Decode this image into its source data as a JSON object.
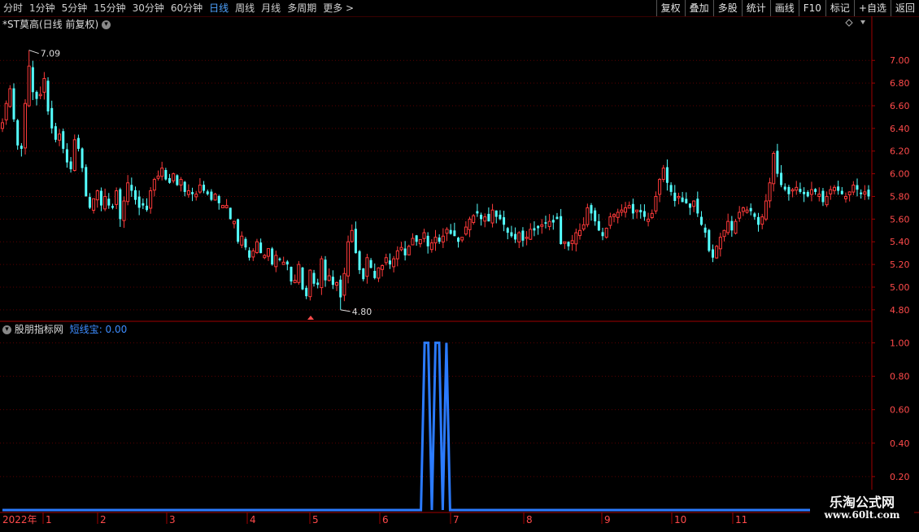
{
  "toolbar": {
    "periods": [
      "分时",
      "1分钟",
      "5分钟",
      "15分钟",
      "30分钟",
      "60分钟",
      "日线",
      "周线",
      "月线",
      "多周期",
      "更多 >"
    ],
    "active_period": "日线",
    "right_buttons": [
      "复权",
      "叠加",
      "多股",
      "统计",
      "画线",
      "F10",
      "标记",
      "+自选",
      "返回"
    ]
  },
  "main_panel": {
    "title": "*ST莫高(日线 前复权)",
    "high_label": "7.09",
    "low_label": "4.80",
    "y_ticks": [
      "7.00",
      "6.80",
      "6.60",
      "6.40",
      "6.20",
      "6.00",
      "5.80",
      "5.60",
      "5.40",
      "5.20",
      "5.00",
      "4.80"
    ]
  },
  "indicator_panel": {
    "title": "股朋指标网",
    "indicator_name": "短线宝",
    "indicator_value": "0.00",
    "y_ticks": [
      "1.00",
      "0.80",
      "0.60",
      "0.40",
      "0.20"
    ]
  },
  "x_axis": {
    "year_label": "2022年",
    "month_labels": [
      "1",
      "2",
      "3",
      "4",
      "5",
      "6",
      "7",
      "8",
      "9",
      "10",
      "11"
    ]
  },
  "watermark": {
    "line1": "乐淘公式网",
    "line2": "www.60lt.com"
  },
  "colors": {
    "up": "#ff3a3a",
    "down": "#54ffff",
    "indicator": "#2b7bff",
    "axis": "#a00000",
    "active": "#4fa3ff"
  },
  "chart_data": {
    "type": "candlestick",
    "price_range": [
      4.72,
      7.26
    ],
    "closes": [
      6.45,
      6.62,
      6.75,
      6.48,
      6.25,
      6.22,
      6.62,
      6.95,
      6.72,
      6.66,
      6.7,
      6.84,
      6.55,
      6.4,
      6.3,
      6.35,
      6.22,
      6.1,
      6.04,
      6.3,
      6.22,
      6.05,
      5.8,
      5.7,
      5.78,
      5.85,
      5.72,
      5.8,
      5.72,
      5.7,
      5.85,
      5.6,
      5.76,
      5.92,
      5.85,
      5.77,
      5.7,
      5.72,
      5.68,
      5.85,
      5.95,
      5.98,
      6.05,
      5.95,
      5.92,
      6.0,
      5.9,
      5.95,
      5.84,
      5.85,
      5.82,
      5.82,
      5.9,
      5.85,
      5.82,
      5.77,
      5.82,
      5.74,
      5.72,
      5.72,
      5.6,
      5.58,
      5.4,
      5.45,
      5.35,
      5.26,
      5.32,
      5.4,
      5.3,
      5.28,
      5.34,
      5.2,
      5.28,
      5.24,
      5.22,
      5.2,
      5.05,
      5.06,
      5.2,
      4.98,
      4.92,
      5.15,
      5.03,
      5.02,
      5.25,
      5.06,
      5.1,
      5.02,
      5.04,
      4.91,
      5.12,
      5.4,
      5.5,
      5.3,
      5.15,
      5.07,
      5.26,
      5.17,
      5.08,
      5.17,
      5.19,
      5.26,
      5.2,
      5.25,
      5.32,
      5.35,
      5.28,
      5.36,
      5.43,
      5.4,
      5.42,
      5.48,
      5.36,
      5.39,
      5.44,
      5.4,
      5.45,
      5.51,
      5.47,
      5.45,
      5.4,
      5.44,
      5.53,
      5.6,
      5.63,
      5.65,
      5.6,
      5.62,
      5.58,
      5.68,
      5.62,
      5.6,
      5.55,
      5.48,
      5.45,
      5.42,
      5.48,
      5.41,
      5.44,
      5.51,
      5.5,
      5.52,
      5.55,
      5.56,
      5.58,
      5.57,
      5.6,
      5.38,
      5.4,
      5.36,
      5.41,
      5.48,
      5.5,
      5.55,
      5.7,
      5.65,
      5.58,
      5.5,
      5.45,
      5.52,
      5.62,
      5.64,
      5.66,
      5.68,
      5.7,
      5.72,
      5.65,
      5.68,
      5.66,
      5.62,
      5.6,
      5.65,
      5.8,
      5.95,
      6.05,
      5.92,
      5.84,
      5.76,
      5.8,
      5.75,
      5.74,
      5.7,
      5.76,
      5.65,
      5.55,
      5.48,
      5.32,
      5.26,
      5.36,
      5.44,
      5.5,
      5.58,
      5.5,
      5.58,
      5.66,
      5.7,
      5.68,
      5.67,
      5.62,
      5.55,
      5.62,
      5.76,
      5.92,
      6.18,
      6.0,
      5.9,
      5.86,
      5.82,
      5.86,
      5.88,
      5.84,
      5.82,
      5.8,
      5.86,
      5.84,
      5.82,
      5.75,
      5.8,
      5.86,
      5.88,
      5.85,
      5.82,
      5.8,
      5.84,
      5.9,
      5.86,
      5.82,
      5.84,
      5.8
    ],
    "high": 7.09,
    "low": 4.8,
    "indicator_values": [
      0,
      0,
      0,
      0,
      0,
      0,
      0,
      0,
      0,
      0,
      0,
      0,
      0,
      0,
      0,
      0,
      0,
      0,
      0,
      0,
      0,
      0,
      0,
      0,
      0,
      0,
      0,
      0,
      0,
      0,
      0,
      0,
      0,
      0,
      0,
      0,
      0,
      0,
      0,
      0,
      0,
      0,
      0,
      0,
      0,
      0,
      0,
      0,
      0,
      0,
      0,
      0,
      0,
      0,
      0,
      0,
      0,
      0,
      0,
      0,
      0,
      0,
      0,
      0,
      0,
      0,
      0,
      0,
      0,
      0,
      0,
      0,
      0,
      0,
      0,
      0,
      0,
      0,
      0,
      0,
      0,
      0,
      0,
      0,
      0,
      0,
      0,
      0,
      0,
      0,
      0,
      0,
      0,
      0,
      0,
      0,
      0,
      0,
      0,
      0,
      0,
      0,
      0,
      0,
      0,
      0,
      0,
      0,
      0,
      0,
      0,
      0,
      0,
      0,
      0,
      0,
      1,
      1,
      0,
      1,
      1,
      0,
      1,
      0,
      0,
      0,
      0,
      0,
      0,
      0,
      0,
      0,
      0,
      0,
      0,
      0,
      0,
      0,
      0,
      0,
      0,
      0,
      0,
      0,
      0,
      0,
      0,
      0,
      0,
      0,
      0,
      0,
      0,
      0,
      0,
      0,
      0,
      0,
      0,
      0,
      0,
      0,
      0,
      0,
      0,
      0,
      0,
      0,
      0,
      0,
      0,
      0,
      0,
      0,
      0,
      0,
      0,
      0,
      0,
      0,
      0,
      0,
      0,
      0,
      0,
      0,
      0,
      0,
      0,
      0,
      0,
      0,
      0,
      0,
      0,
      0,
      0,
      0,
      0,
      0,
      0,
      0,
      0,
      0,
      0,
      0,
      0,
      0,
      0,
      0,
      0,
      0,
      0,
      0,
      0,
      0,
      0,
      0,
      0,
      0,
      0,
      0,
      0,
      0,
      0,
      0,
      0,
      0,
      0,
      0,
      0,
      0,
      0,
      0,
      0,
      0,
      0,
      0,
      0
    ],
    "indicator_range": [
      0,
      1.08
    ]
  }
}
